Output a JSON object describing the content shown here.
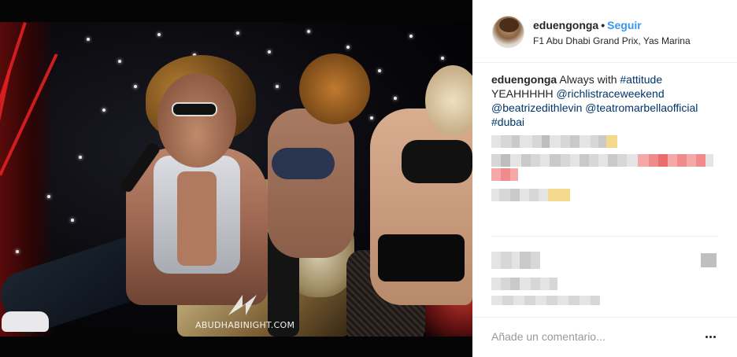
{
  "post": {
    "username": "eduengonga",
    "separator": "•",
    "follow_label": "Seguir",
    "location": "F1 Abu Dhabi Grand Prix, Yas Marina"
  },
  "caption": {
    "username": "eduengonga",
    "text": "Always with",
    "hashtag1": "#attitude",
    "line2": "YEAHHHHH",
    "mention1": "@richlistraceweekend",
    "mention2": "@beatrizedithlevin",
    "mention3": "@teatromarbellaofficial",
    "hashtag2": "#dubai"
  },
  "photo": {
    "watermark_text": "ABUDHABINIGHT.COM"
  },
  "comment_box": {
    "placeholder": "Añade un comentario..."
  },
  "icons": {
    "more": "more-options-icon",
    "watermark_logo": "abudhabinight-logo-icon"
  },
  "colors": {
    "link": "#003569",
    "follow": "#3897f0",
    "text": "#262626"
  }
}
